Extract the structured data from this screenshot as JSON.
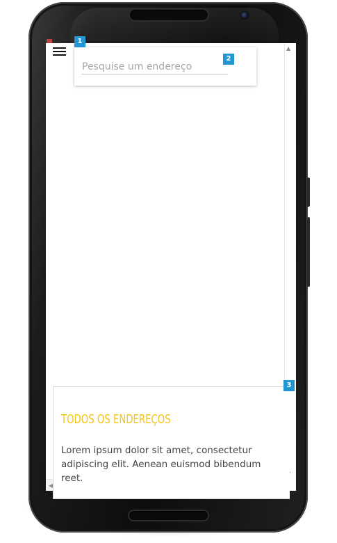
{
  "badges": {
    "one": "1",
    "two": "2",
    "three": "3"
  },
  "search": {
    "placeholder": "Pesquise um endereço",
    "value": ""
  },
  "panel": {
    "title": "Todos os endereços",
    "body": "Lorem ipsum dolor sit amet, consectetur adipiscing elit. Aenean euismod bibendum reet."
  },
  "scroll": {
    "up": "▲",
    "down": "▼",
    "left": "◀"
  },
  "colors": {
    "badge": "#2196d3",
    "title": "#f5c518",
    "menu": "#111111"
  },
  "icons": {
    "menu": "hamburger-menu-icon"
  }
}
